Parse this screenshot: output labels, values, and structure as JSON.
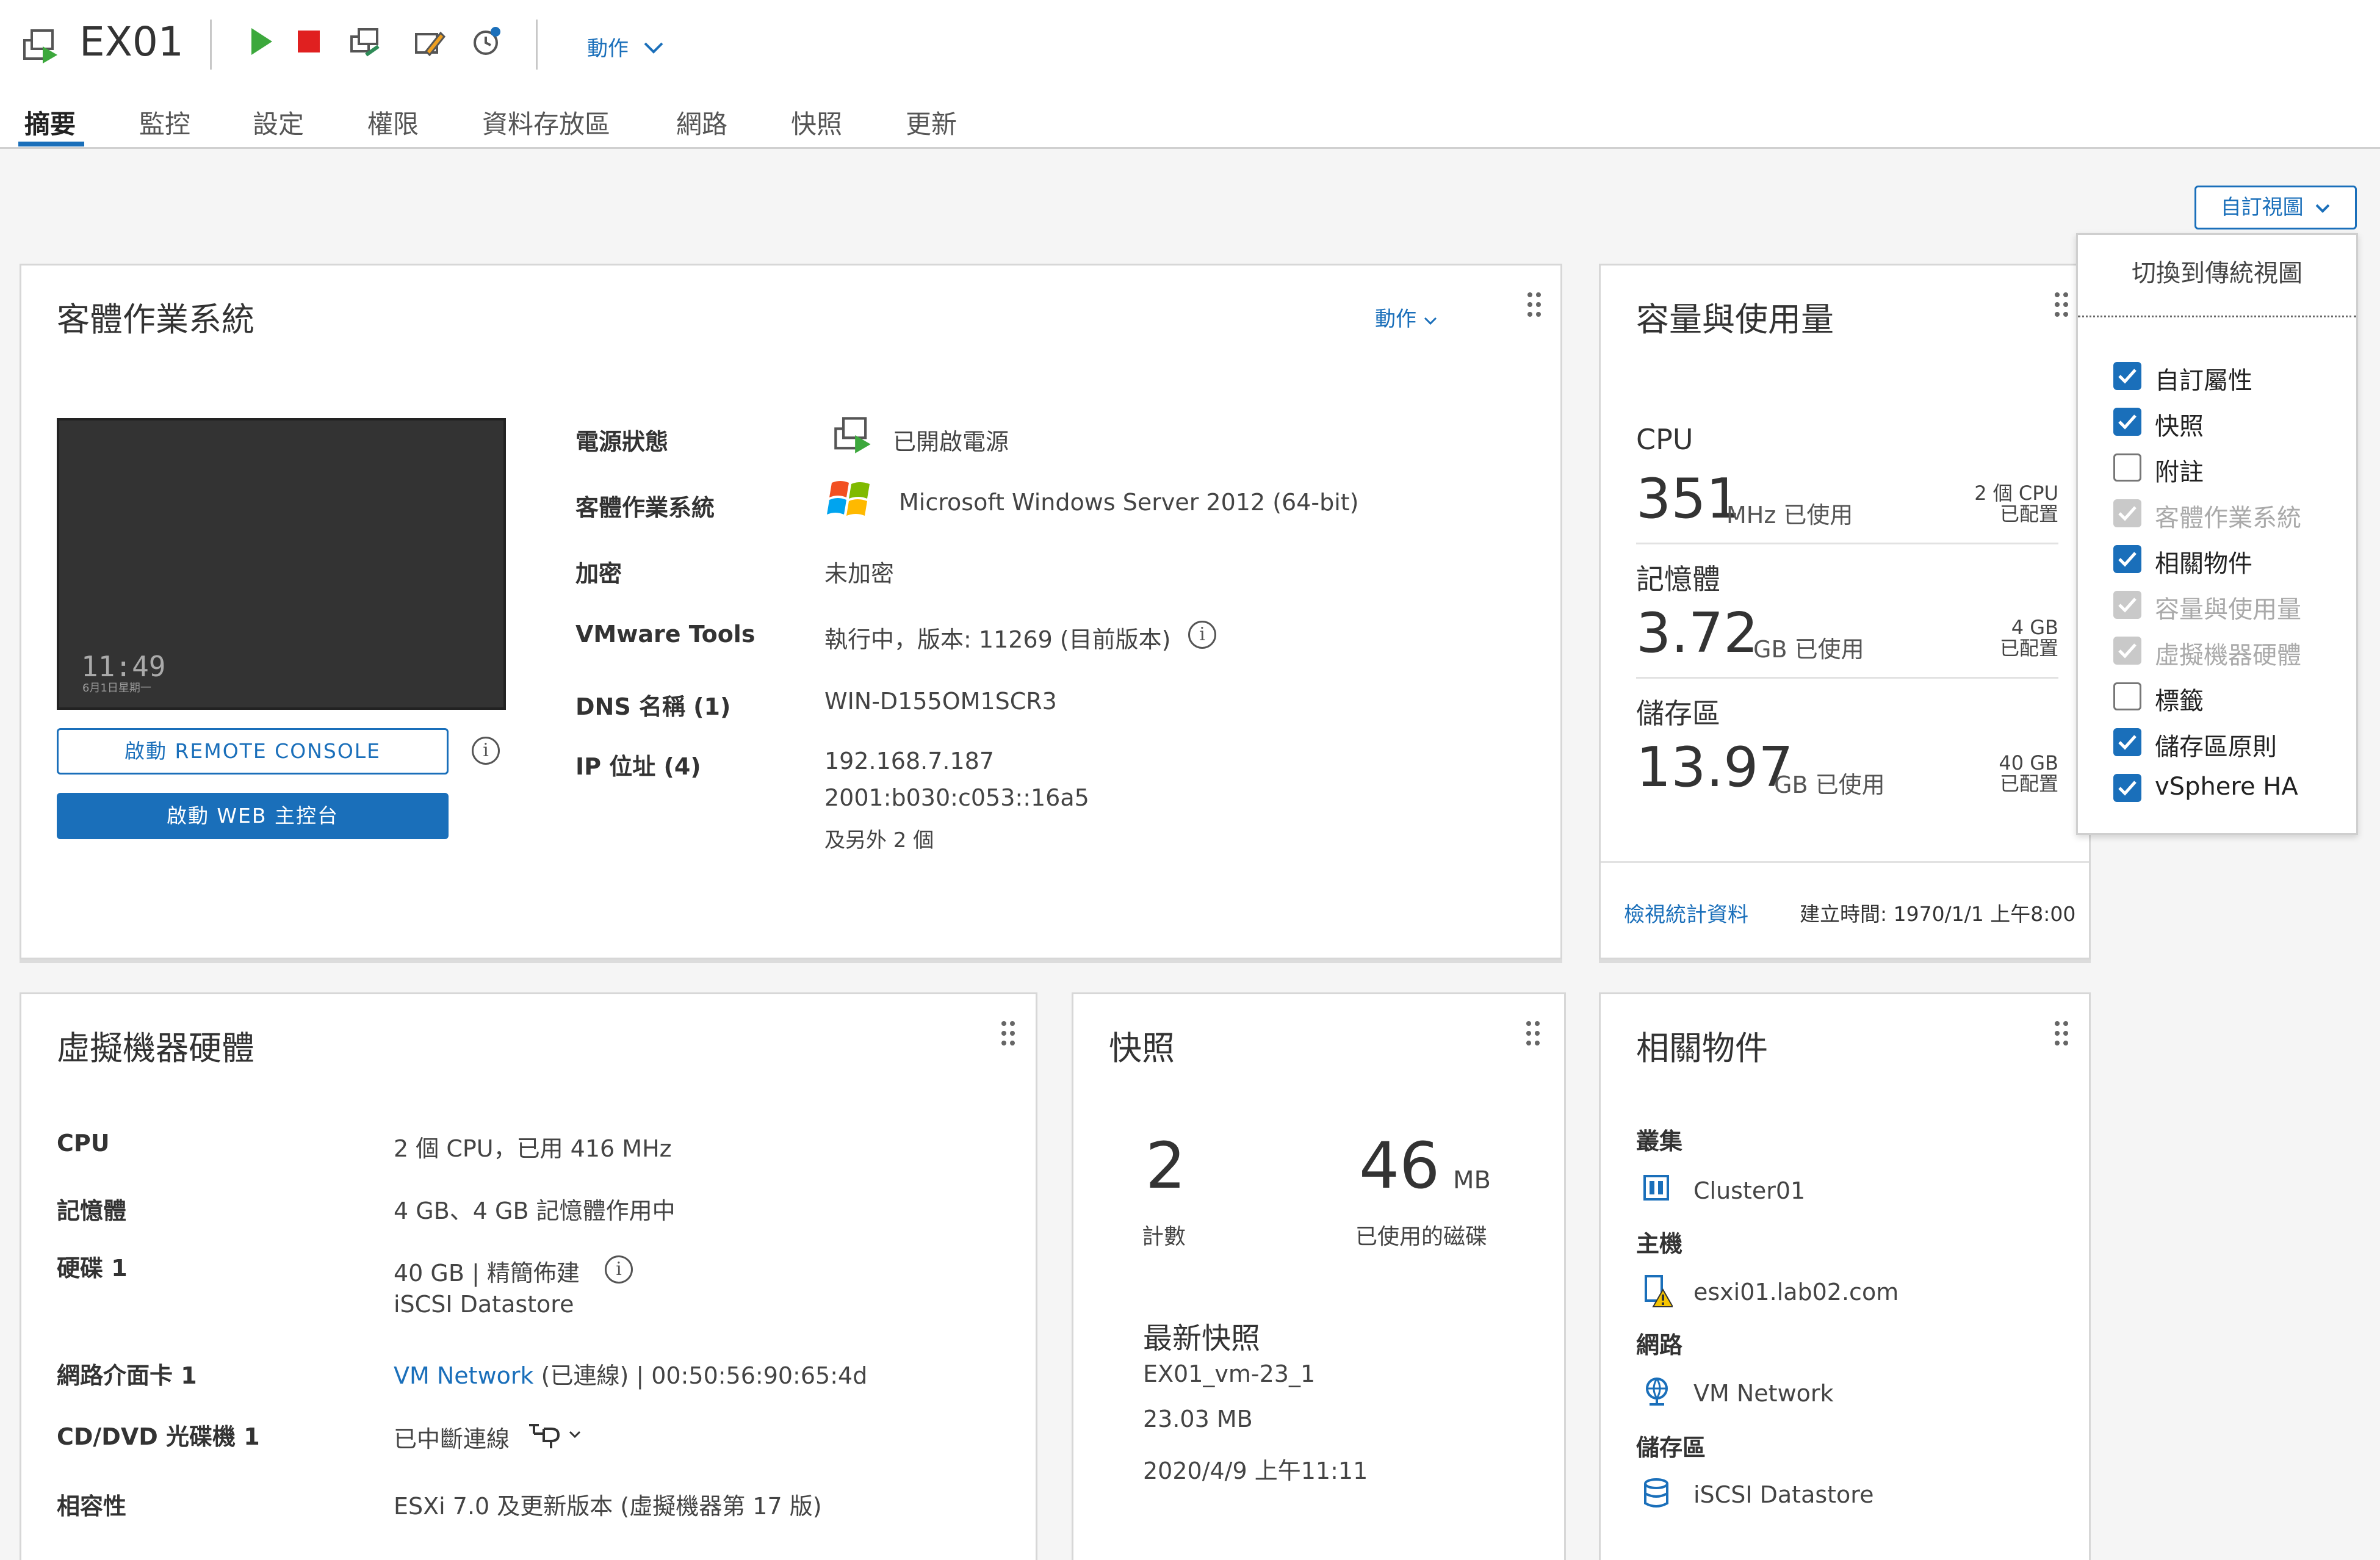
{
  "header": {
    "vm_name": "EX01",
    "actions_label": "動作",
    "tabs": [
      "摘要",
      "監控",
      "設定",
      "權限",
      "資料存放區",
      "網路",
      "快照",
      "更新"
    ]
  },
  "custom_view": {
    "button_label": "自訂視圖",
    "switch_label": "切換到傳統視圖",
    "options": [
      {
        "label": "自訂屬性",
        "state": "checked"
      },
      {
        "label": "快照",
        "state": "checked"
      },
      {
        "label": "附註",
        "state": "unchecked"
      },
      {
        "label": "客體作業系統",
        "state": "disabled"
      },
      {
        "label": "相關物件",
        "state": "checked"
      },
      {
        "label": "容量與使用量",
        "state": "disabled"
      },
      {
        "label": "虛擬機器硬體",
        "state": "disabled"
      },
      {
        "label": "標籤",
        "state": "unchecked"
      },
      {
        "label": "儲存區原則",
        "state": "checked"
      },
      {
        "label": "vSphere HA",
        "state": "checked"
      }
    ]
  },
  "guest_os": {
    "title": "客體作業系統",
    "actions_label": "動作",
    "console_clock": "11:49",
    "console_date": "6月1日星期一",
    "remote_console_label": "啟動 REMOTE CONSOLE",
    "web_console_label": "啟動 WEB 主控台",
    "rows": [
      {
        "label": "電源狀態",
        "value": "已開啟電源"
      },
      {
        "label": "客體作業系統",
        "value": "Microsoft Windows Server 2012 (64-bit)"
      },
      {
        "label": "加密",
        "value": "未加密"
      },
      {
        "label": "VMware Tools",
        "value": "執行中，版本: 11269 (目前版本)"
      },
      {
        "label": "DNS 名稱 (1)",
        "value": "WIN-D155OM1SCR3"
      },
      {
        "label": "IP 位址 (4)",
        "value": "192.168.7.187"
      }
    ],
    "ip_extra": "2001:b030:c053::16a5",
    "ip_more_link": "及另外 2 個"
  },
  "capacity": {
    "title": "容量與使用量",
    "items": [
      {
        "name": "CPU",
        "value": "351",
        "unit": "MHz 已使用",
        "alloc_top": "2 個 CPU",
        "alloc_bottom": "已配置"
      },
      {
        "name": "記憶體",
        "value": "3.72",
        "unit": "GB 已使用",
        "alloc_top": "4 GB",
        "alloc_bottom": "已配置"
      },
      {
        "name": "儲存區",
        "value": "13.97",
        "unit": "GB 已使用",
        "alloc_top": "40 GB",
        "alloc_bottom": "已配置"
      }
    ],
    "stats_link": "檢視統計資料",
    "created": "建立時間: 1970/1/1 上午8:00"
  },
  "hardware": {
    "title": "虛擬機器硬體",
    "rows": [
      {
        "label": "CPU",
        "value": "2 個 CPU，已用 416 MHz"
      },
      {
        "label": "記憶體",
        "value": "4 GB、4 GB 記憶體作用中"
      },
      {
        "label": "硬碟 1",
        "value": "40 GB | 精簡佈建"
      },
      {
        "label": "網路介面卡 1",
        "value": "(已連線) | 00:50:56:90:65:4d"
      },
      {
        "label": "CD/DVD 光碟機 1",
        "value": "已中斷連線"
      },
      {
        "label": "相容性",
        "value": "ESXi 7.0 及更新版本 (虛擬機器第 17 版)"
      }
    ],
    "disk_link": "iSCSI Datastore",
    "network_link": "VM Network"
  },
  "snapshots": {
    "title": "快照",
    "count": "2",
    "count_label": "計數",
    "size": "46",
    "size_unit": "MB",
    "size_label": "已使用的磁碟",
    "latest_title": "最新快照",
    "latest_name": "EX01_vm-23_1",
    "latest_size": "23.03 MB",
    "latest_date": "2020/4/9 上午11:11"
  },
  "related": {
    "title": "相關物件",
    "groups": [
      {
        "label": "叢集",
        "item": "Cluster01",
        "icon": "cluster-icon"
      },
      {
        "label": "主機",
        "item": "esxi01.lab02.com",
        "icon": "host-warning-icon"
      },
      {
        "label": "網路",
        "item": "VM Network",
        "icon": "network-icon"
      },
      {
        "label": "儲存區",
        "item": "iSCSI Datastore",
        "icon": "datastore-icon"
      }
    ]
  },
  "colors": {
    "accent": "#1a6fba",
    "stop": "#e02020",
    "play": "#3ca83c"
  }
}
